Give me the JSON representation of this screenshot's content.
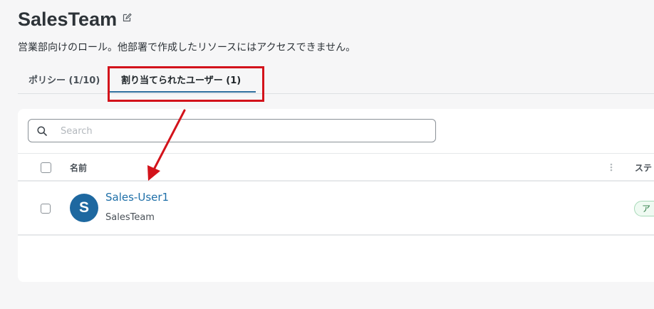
{
  "header": {
    "title": "SalesTeam",
    "description": "営業部向けのロール。他部署で作成したリソースにはアクセスできません。"
  },
  "tabs": [
    {
      "label": "ポリシー (1/10)",
      "active": false
    },
    {
      "label": "割り当てられたユーザー (1)",
      "active": true
    }
  ],
  "search": {
    "placeholder": "Search",
    "value": ""
  },
  "table": {
    "columns": [
      "名前",
      "ステ"
    ],
    "rows": [
      {
        "avatar_letter": "S",
        "name": "Sales-User1",
        "group": "SalesTeam",
        "status": "ア"
      }
    ]
  },
  "colors": {
    "accent": "#2f6f9e",
    "avatar": "#1e68a0",
    "annotation": "#d3131b",
    "status_badge": "#effaf2"
  },
  "icons": [
    "edit-icon",
    "search-icon",
    "sort-icon",
    "arrow-annotation"
  ]
}
